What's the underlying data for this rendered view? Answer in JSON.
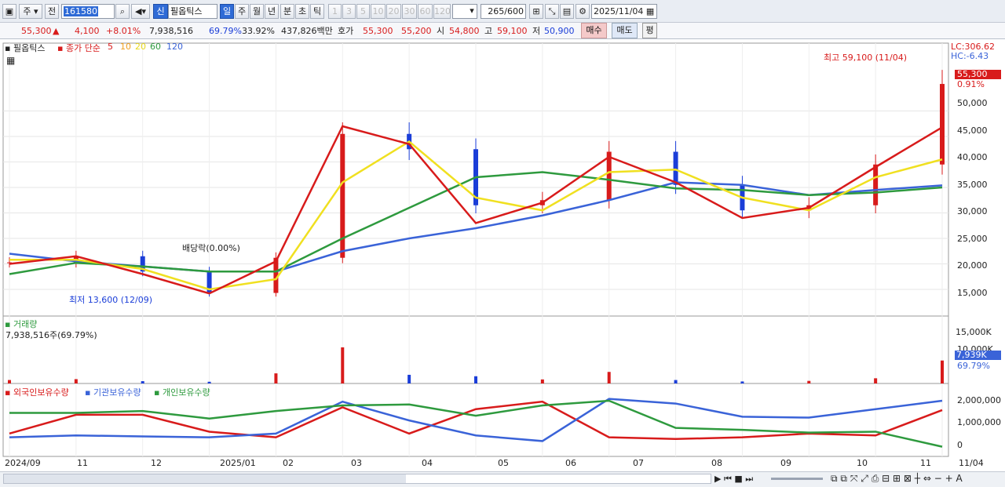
{
  "toolbar": {
    "market_label": "주",
    "prev_label": "전",
    "code": "161580",
    "name": "필옵틱스",
    "credit_label": "신",
    "periods": [
      "일",
      "주",
      "월",
      "년",
      "분",
      "초",
      "틱"
    ],
    "minutes": [
      "1",
      "3",
      "5",
      "10",
      "20",
      "30",
      "60",
      "120"
    ],
    "count": "265",
    "count_total": "/600",
    "date": "2025/11/04"
  },
  "quote": {
    "price": "55,300",
    "up_arrow": "▲",
    "change": "4,100",
    "rate": "+8.01%",
    "volume": "7,938,516",
    "vol_ratio": "69.79%",
    "turnover": "33.92%",
    "amount": "437,826백만",
    "hoga_label": "호가",
    "ask": "55,300",
    "bid": "55,200",
    "open_label": "시",
    "open": "54,800",
    "high_label": "고",
    "high": "59,100",
    "low_label": "저",
    "low": "50,900",
    "buy": "매수",
    "sell": "매도",
    "flat": "평"
  },
  "legend": {
    "name": "필옵틱스",
    "close_label": "종가 단순",
    "ma": [
      {
        "p": "5",
        "color": "#d81b1b"
      },
      {
        "p": "10",
        "color": "#f0a020"
      },
      {
        "p": "20",
        "color": "#f0e020"
      },
      {
        "p": "60",
        "color": "#2e9a3e"
      },
      {
        "p": "120",
        "color": "#3a63d8"
      }
    ]
  },
  "annotations": {
    "lc": "LC:306.62",
    "hc": "HC:-6.43",
    "high_note": "최고 59,100 (11/04)",
    "low_note": "최저 13,600 (12/09)",
    "dividend": "배당락(0.00%)",
    "last_price": "55,300",
    "last_rate": "0.91%"
  },
  "price_axis": [
    "50,000",
    "45,000",
    "40,000",
    "35,000",
    "30,000",
    "25,000",
    "20,000",
    "15,000"
  ],
  "volume_panel": {
    "title": "거래량",
    "value": "7,938,516주(69.79%)",
    "axis": [
      "15,000K",
      "10,000K"
    ],
    "last": "7,939K",
    "last_ratio": "69.79%"
  },
  "holder_panel": {
    "legend": [
      "외국인보유수량",
      "기관보유수량",
      "개인보유수량"
    ],
    "colors": [
      "#d81b1b",
      "#3a63d8",
      "#2e9a3e"
    ],
    "axis": [
      "2,000,000",
      "1,000,000",
      "0"
    ]
  },
  "date_axis": [
    "2024/09",
    "11",
    "12",
    "2025/01",
    "02",
    "03",
    "04",
    "05",
    "06",
    "07",
    "08",
    "09",
    "10",
    "11",
    "11/04"
  ],
  "chart_data": {
    "type": "candlestick",
    "title": "필옵틱스",
    "ylim": [
      11000,
      61000
    ],
    "x": [
      "2024/09",
      "2024/10",
      "2024/11",
      "2024/12",
      "2025/01",
      "2025/02",
      "2025/03",
      "2025/04",
      "2025/05",
      "2025/06",
      "2025/07",
      "2025/08",
      "2025/09",
      "2025/10",
      "2025/11/04"
    ],
    "close": [
      20300,
      21500,
      18500,
      14300,
      21200,
      45500,
      42500,
      31500,
      32500,
      42000,
      35500,
      30500,
      31500,
      39500,
      55300
    ],
    "ma5": [
      20000,
      21500,
      18000,
      14200,
      20500,
      47000,
      43500,
      28000,
      32000,
      41000,
      36000,
      29000,
      31000,
      39000,
      46800
    ],
    "ma20": [
      20800,
      20800,
      19000,
      15000,
      17000,
      36000,
      44000,
      33000,
      30500,
      38000,
      38500,
      33000,
      30500,
      37000,
      40500
    ],
    "ma60": [
      18000,
      20200,
      19500,
      18500,
      18500,
      25000,
      31000,
      37000,
      38000,
      36500,
      34800,
      34500,
      33500,
      34000,
      35000
    ],
    "ma120": [
      22000,
      20500,
      19500,
      18500,
      18500,
      22500,
      25000,
      27000,
      29500,
      32500,
      36000,
      35500,
      33500,
      34500,
      35400
    ],
    "volume_k": [
      1200,
      1500,
      800,
      600,
      3500,
      12500,
      3000,
      2500,
      1400,
      4000,
      1200,
      700,
      900,
      1800,
      7939
    ],
    "foreign": [
      300000,
      1300000,
      1300000,
      400000,
      100000,
      1700000,
      300000,
      1600000,
      2000000,
      100000,
      10000,
      100000,
      300000,
      200000,
      1550000
    ],
    "institution": [
      100000,
      200000,
      150000,
      100000,
      300000,
      2000000,
      1000000,
      200000,
      -100000,
      2150000,
      1900000,
      1200000,
      1150000,
      1600000,
      2050000
    ],
    "individual": [
      1400000,
      1400000,
      1500000,
      1100000,
      1500000,
      1800000,
      1850000,
      1250000,
      1800000,
      2050000,
      600000,
      500000,
      350000,
      400000,
      -400000
    ]
  }
}
